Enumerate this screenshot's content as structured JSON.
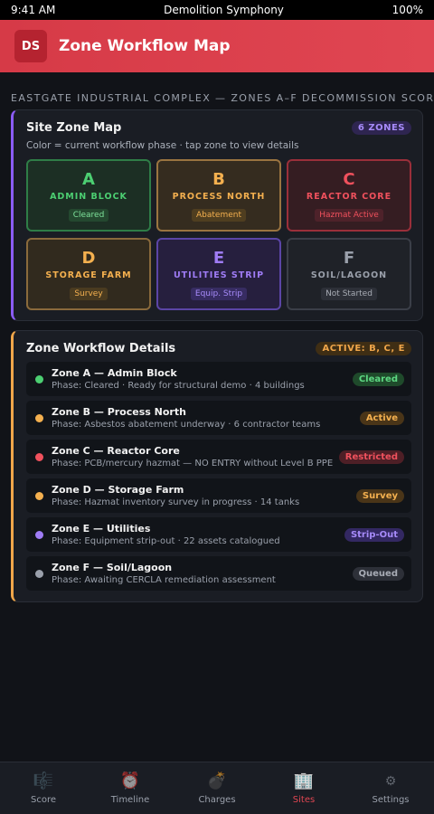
{
  "status_bar": {
    "time": "9:41 AM",
    "app": "Demolition Symphony",
    "battery": "100%"
  },
  "header": {
    "logo": "DS",
    "title": "Zone Workflow Map"
  },
  "section_caption": "EASTGATE INDUSTRIAL COMPLEX — ZONES A–F DECOMMISSION SCORE",
  "map_card": {
    "title": "Site Zone Map",
    "count_pill": "6 ZONES",
    "subtitle": "Color = current workflow phase · tap zone to view details",
    "zones": [
      {
        "letter": "A",
        "name": "ADMIN BLOCK",
        "tag": "Cleared",
        "color": "#4ccf72"
      },
      {
        "letter": "B",
        "name": "PROCESS NORTH",
        "tag": "Abatement",
        "color": "#f4b04f"
      },
      {
        "letter": "C",
        "name": "REACTOR CORE",
        "tag": "Hazmat Active",
        "color": "#f0515d"
      },
      {
        "letter": "D",
        "name": "STORAGE FARM",
        "tag": "Survey",
        "color": "#f4b04f"
      },
      {
        "letter": "E",
        "name": "UTILITIES STRIP",
        "tag": "Equip. Strip",
        "color": "#9f7cf5"
      },
      {
        "letter": "F",
        "name": "SOIL/LAGOON",
        "tag": "Not Started",
        "color": "#9aa0ab"
      }
    ]
  },
  "details_card": {
    "title": "Zone Workflow Details",
    "active_pill": "ACTIVE: B, C, E",
    "rows": [
      {
        "title": "Zone A — Admin Block",
        "phase": "Phase: Cleared · Ready for structural demo · 4 buildings",
        "badge": "Cleared",
        "color": "#4ccf72"
      },
      {
        "title": "Zone B — Process North",
        "phase": "Phase: Asbestos abatement underway · 6 contractor teams",
        "badge": "Active",
        "color": "#f4b04f"
      },
      {
        "title": "Zone C — Reactor Core",
        "phase": "Phase: PCB/mercury hazmat — NO ENTRY without Level B PPE",
        "badge": "Restricted",
        "color": "#f0515d"
      },
      {
        "title": "Zone D — Storage Farm",
        "phase": "Phase: Hazmat inventory survey in progress · 14 tanks",
        "badge": "Survey",
        "color": "#f4b04f"
      },
      {
        "title": "Zone E — Utilities",
        "phase": "Phase: Equipment strip-out · 22 assets catalogued",
        "badge": "Strip-Out",
        "color": "#9f7cf5"
      },
      {
        "title": "Zone F — Soil/Lagoon",
        "phase": "Phase: Awaiting CERCLA remediation assessment",
        "badge": "Queued",
        "color": "#9aa0ab"
      }
    ]
  },
  "nav": {
    "active": "Sites",
    "active_color": "#e04652",
    "items": [
      {
        "label": "Score",
        "icon": "score-icon"
      },
      {
        "label": "Timeline",
        "icon": "alarm-clock-icon"
      },
      {
        "label": "Charges",
        "icon": "bomb-icon"
      },
      {
        "label": "Sites",
        "icon": "buildings-icon"
      },
      {
        "label": "Settings",
        "icon": "gear-icon"
      }
    ]
  }
}
